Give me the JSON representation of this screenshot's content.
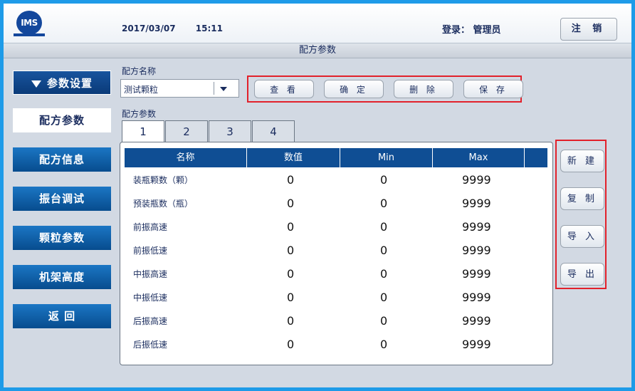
{
  "header": {
    "logo_text": "IMS",
    "date": "2017/03/07",
    "time": "15:11",
    "login_label": "登录：",
    "user": "管理员",
    "logout_label": "注 销"
  },
  "page_title": "配方参数",
  "sidebar": {
    "items": [
      {
        "label": "参数设置",
        "state": "header"
      },
      {
        "label": "配方参数",
        "state": "selected"
      },
      {
        "label": "配方信息",
        "state": "normal"
      },
      {
        "label": "振台调试",
        "state": "normal"
      },
      {
        "label": "颗粒参数",
        "state": "normal"
      },
      {
        "label": "机架高度",
        "state": "normal"
      },
      {
        "label": "返 回",
        "state": "normal"
      }
    ]
  },
  "recipe": {
    "name_label": "配方名称",
    "selected_value": "测试颗粒",
    "actions": [
      "查 看",
      "确 定",
      "删 除",
      "保 存"
    ]
  },
  "params": {
    "section_label": "配方参数",
    "tabs": [
      "1",
      "2",
      "3",
      "4"
    ],
    "active_tab": "1",
    "columns": [
      "名称",
      "数值",
      "Min",
      "Max"
    ],
    "rows": [
      [
        "装瓶颗数（颗）",
        "0",
        "0",
        "9999"
      ],
      [
        "预装瓶数（瓶）",
        "0",
        "0",
        "9999"
      ],
      [
        "前振高速",
        "0",
        "0",
        "9999"
      ],
      [
        "前振低速",
        "0",
        "0",
        "9999"
      ],
      [
        "中振高速",
        "0",
        "0",
        "9999"
      ],
      [
        "中振低速",
        "0",
        "0",
        "9999"
      ],
      [
        "后振高速",
        "0",
        "0",
        "9999"
      ],
      [
        "后振低速",
        "0",
        "0",
        "9999"
      ]
    ]
  },
  "side_buttons": [
    "新 建",
    "复 制",
    "导 入",
    "导 出"
  ],
  "colors": {
    "frame": "#1e9be8",
    "sidebar_button": "#0d5ea8",
    "table_header": "#0f4e94",
    "highlight_box": "#e2212b"
  }
}
